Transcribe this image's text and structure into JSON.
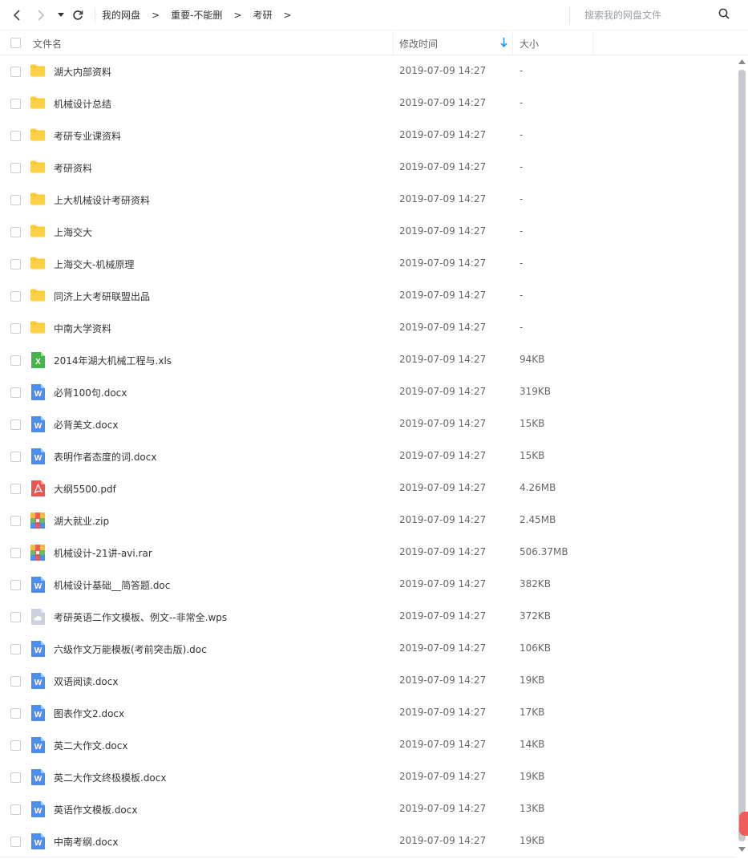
{
  "toolbar": {
    "breadcrumbs": [
      "我的网盘",
      "重要-不能删",
      "考研"
    ],
    "separator": ">",
    "search_placeholder": "搜索我的网盘文件"
  },
  "columns": {
    "name": "文件名",
    "time": "修改时间",
    "size": "大小"
  },
  "colors": {
    "folder": "#ffc933",
    "word": "#4a8ef0",
    "excel": "#44b549",
    "pdf": "#ef5350",
    "zip": "#4a8ef0",
    "wps": "#c9d2de",
    "accent": "#1e8fe8"
  },
  "files": [
    {
      "name": "湖大内部资料",
      "time": "2019-07-09 14:27",
      "size": "-",
      "icon": "folder-icon"
    },
    {
      "name": "机械设计总结",
      "time": "2019-07-09 14:27",
      "size": "-",
      "icon": "folder-icon"
    },
    {
      "name": "考研专业课资料",
      "time": "2019-07-09 14:27",
      "size": "-",
      "icon": "folder-icon"
    },
    {
      "name": "考研资料",
      "time": "2019-07-09 14:27",
      "size": "-",
      "icon": "folder-icon"
    },
    {
      "name": "上大机械设计考研资料",
      "time": "2019-07-09 14:27",
      "size": "-",
      "icon": "folder-icon"
    },
    {
      "name": "上海交大",
      "time": "2019-07-09 14:27",
      "size": "-",
      "icon": "folder-icon"
    },
    {
      "name": "上海交大-机械原理",
      "time": "2019-07-09 14:27",
      "size": "-",
      "icon": "folder-icon"
    },
    {
      "name": "同济上大考研联盟出品",
      "time": "2019-07-09 14:27",
      "size": "-",
      "icon": "folder-icon"
    },
    {
      "name": "中南大学资料",
      "time": "2019-07-09 14:27",
      "size": "-",
      "icon": "folder-icon"
    },
    {
      "name": "2014年湖大机械工程与.xls",
      "time": "2019-07-09 14:27",
      "size": "94KB",
      "icon": "excel-icon"
    },
    {
      "name": "必背100句.docx",
      "time": "2019-07-09 14:27",
      "size": "319KB",
      "icon": "word-icon"
    },
    {
      "name": "必背美文.docx",
      "time": "2019-07-09 14:27",
      "size": "15KB",
      "icon": "word-icon"
    },
    {
      "name": "表明作者态度的词.docx",
      "time": "2019-07-09 14:27",
      "size": "15KB",
      "icon": "word-icon"
    },
    {
      "name": "大纲5500.pdf",
      "time": "2019-07-09 14:27",
      "size": "4.26MB",
      "icon": "pdf-icon"
    },
    {
      "name": "湖大就业.zip",
      "time": "2019-07-09 14:27",
      "size": "2.45MB",
      "icon": "zip-icon"
    },
    {
      "name": "机械设计-21讲-avi.rar",
      "time": "2019-07-09 14:27",
      "size": "506.37MB",
      "icon": "zip-icon"
    },
    {
      "name": "机械设计基础__简答题.doc",
      "time": "2019-07-09 14:27",
      "size": "382KB",
      "icon": "word-icon"
    },
    {
      "name": "考研英语二作文模板、例文--非常全.wps",
      "time": "2019-07-09 14:27",
      "size": "372KB",
      "icon": "wps-icon"
    },
    {
      "name": "六级作文万能模板(考前突击版).doc",
      "time": "2019-07-09 14:27",
      "size": "106KB",
      "icon": "word-icon"
    },
    {
      "name": "双语阅读.docx",
      "time": "2019-07-09 14:27",
      "size": "19KB",
      "icon": "word-icon"
    },
    {
      "name": "图表作文2.docx",
      "time": "2019-07-09 14:27",
      "size": "17KB",
      "icon": "word-icon"
    },
    {
      "name": "英二大作文.docx",
      "time": "2019-07-09 14:27",
      "size": "14KB",
      "icon": "word-icon"
    },
    {
      "name": "英二大作文终极模板.docx",
      "time": "2019-07-09 14:27",
      "size": "19KB",
      "icon": "word-icon"
    },
    {
      "name": "英语作文模板.docx",
      "time": "2019-07-09 14:27",
      "size": "13KB",
      "icon": "word-icon"
    },
    {
      "name": "中南考纲.docx",
      "time": "2019-07-09 14:27",
      "size": "19KB",
      "icon": "word-icon"
    }
  ]
}
